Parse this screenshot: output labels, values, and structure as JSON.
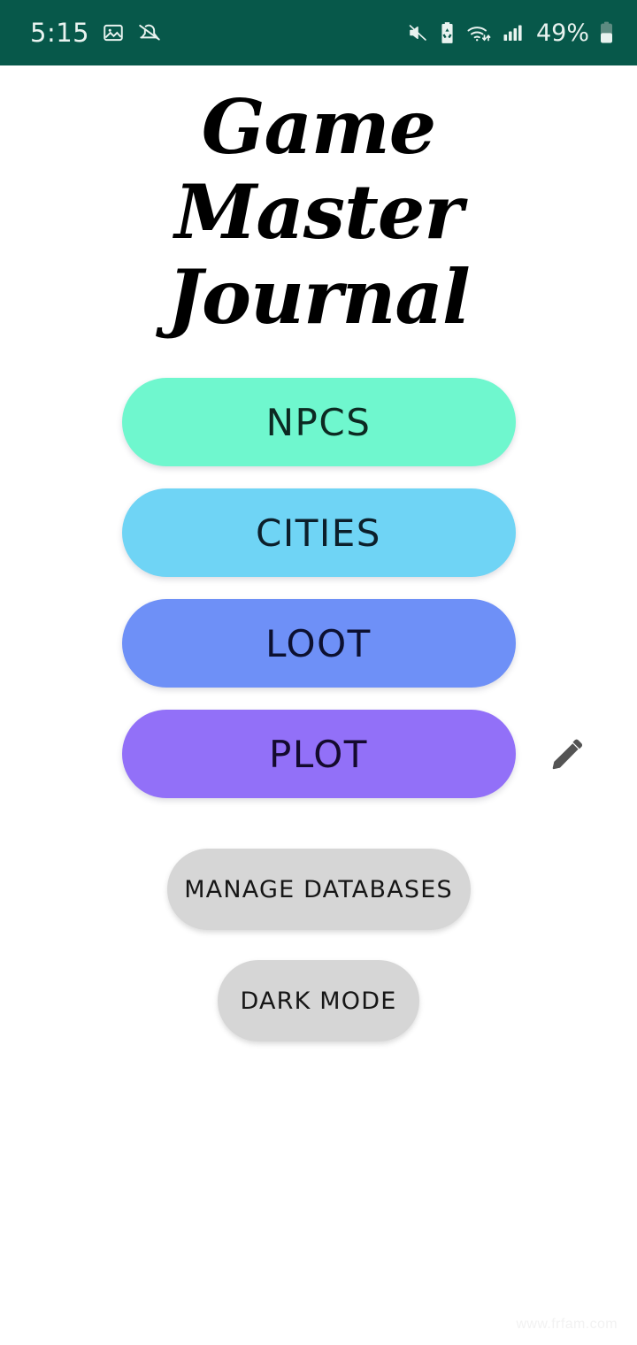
{
  "status_bar": {
    "background_color": "#07584A",
    "time": "5:15",
    "battery_percent": "49%",
    "left_icons": [
      "gallery-image-icon",
      "notification-muted-icon"
    ],
    "right_icons": [
      "volume-mute-icon",
      "battery-saver-icon",
      "wifi-data-icon",
      "cellular-signal-icon",
      "battery-icon"
    ]
  },
  "header": {
    "title": "Game Master Journal"
  },
  "nav": {
    "buttons": [
      {
        "label": "NPCS",
        "color": "#6FF7CE",
        "text_color": "#0c2a22"
      },
      {
        "label": "CITIES",
        "color": "#6FD4F5",
        "text_color": "#0c1f2b"
      },
      {
        "label": "LOOT",
        "color": "#6E90F7",
        "text_color": "#0c1030"
      },
      {
        "label": "PLOT",
        "color": "#9270F8",
        "text_color": "#140a2e"
      }
    ],
    "edit_icon": "pencil-edit-icon",
    "edit_icon_color": "#545454"
  },
  "secondary": {
    "manage_databases_label": "MANAGE DATABASES",
    "dark_mode_label": "DARK MODE",
    "background_color": "#D6D6D6"
  },
  "watermark": {
    "text": "www.frfam.com"
  },
  "theme": {
    "page_background": "#FFFFFF"
  }
}
